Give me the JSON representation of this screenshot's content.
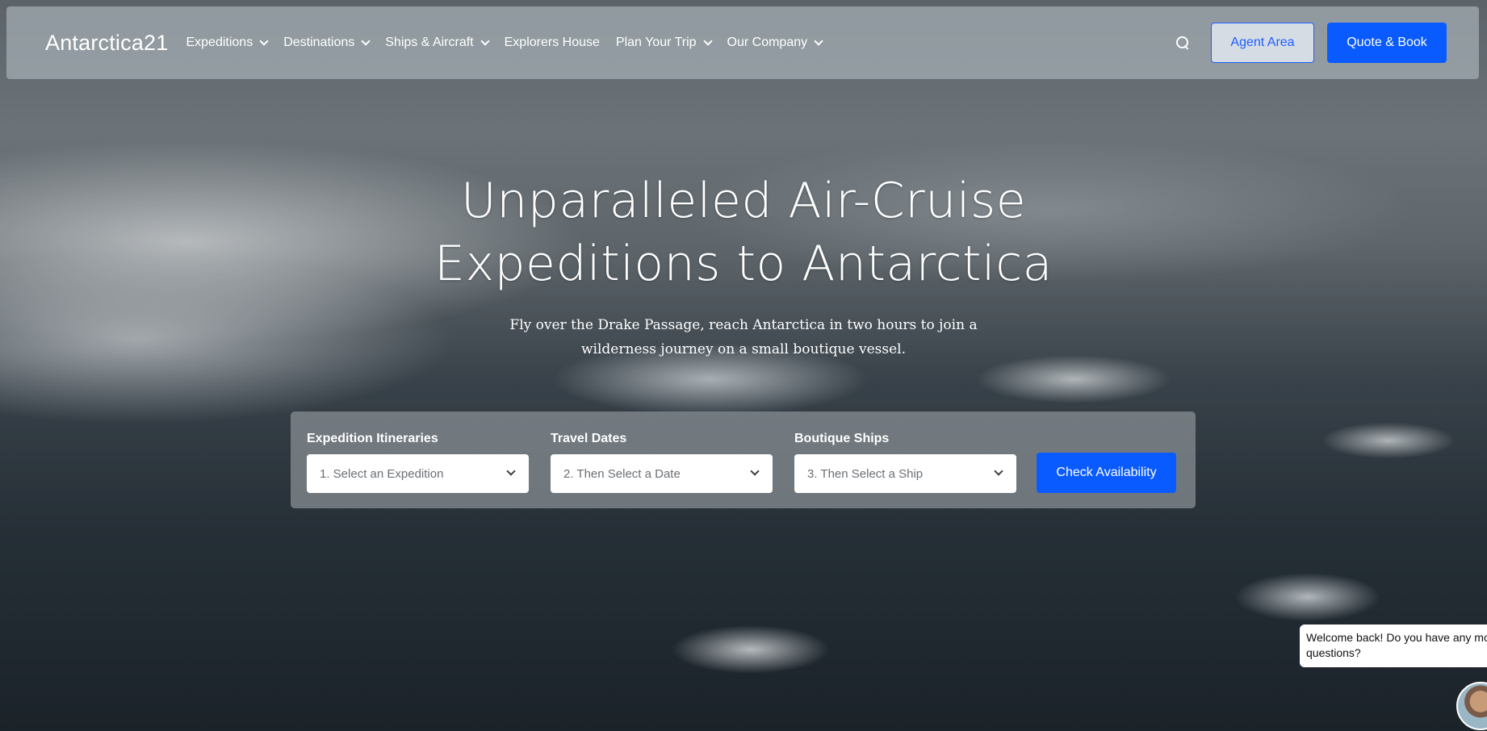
{
  "brand": {
    "logo_text": "Antarctica21"
  },
  "nav": {
    "items": [
      {
        "label": "Expeditions",
        "has_dropdown": true
      },
      {
        "label": "Destinations",
        "has_dropdown": true
      },
      {
        "label": "Ships & Aircraft",
        "has_dropdown": true
      },
      {
        "label": "Explorers House",
        "has_dropdown": false
      },
      {
        "label": "Plan Your Trip",
        "has_dropdown": true
      },
      {
        "label": "Our Company",
        "has_dropdown": true
      }
    ],
    "search_icon": "search-icon",
    "agent_button": "Agent Area",
    "quote_button": "Quote & Book"
  },
  "hero": {
    "title_line1": "Unparalleled Air-Cruise",
    "title_line2": "Expeditions to Antarctica",
    "subtitle_line1": "Fly over the Drake Passage, reach Antarctica in two hours to join a",
    "subtitle_line2": "wilderness journey on a small boutique vessel."
  },
  "booking": {
    "fields": [
      {
        "label": "Expedition Itineraries",
        "value": "1. Select an Expedition"
      },
      {
        "label": "Travel Dates",
        "value": "2. Then Select a Date"
      },
      {
        "label": "Boutique Ships",
        "value": "3. Then Select a Ship"
      }
    ],
    "submit_label": "Check Availability"
  },
  "chat": {
    "message_line1": "Welcome back! Do you have any mo",
    "message_line2": "questions?"
  },
  "colors": {
    "accent": "#0a5bff",
    "nav_background": "#a5aeb4",
    "text_light": "#ffffff"
  }
}
